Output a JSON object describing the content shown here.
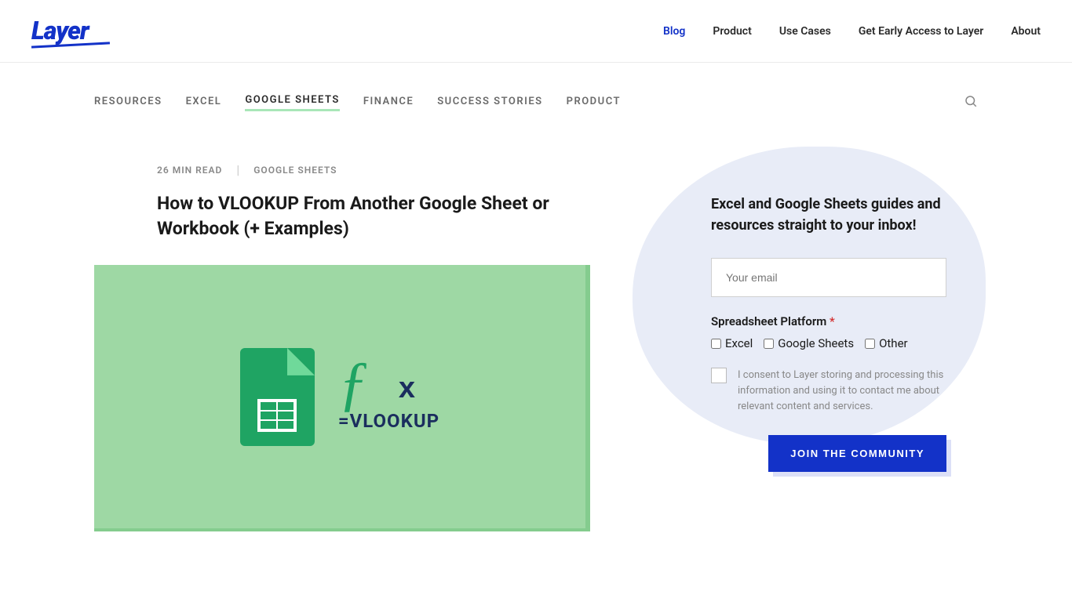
{
  "header": {
    "logo_text": "Layer",
    "nav": [
      {
        "label": "Blog",
        "active": true
      },
      {
        "label": "Product",
        "active": false
      },
      {
        "label": "Use Cases",
        "active": false
      },
      {
        "label": "Get Early Access to Layer",
        "active": false
      },
      {
        "label": "About",
        "active": false
      }
    ]
  },
  "subnav": [
    {
      "label": "RESOURCES",
      "active": false
    },
    {
      "label": "EXCEL",
      "active": false
    },
    {
      "label": "GOOGLE SHEETS",
      "active": true
    },
    {
      "label": "FINANCE",
      "active": false
    },
    {
      "label": "SUCCESS STORIES",
      "active": false
    },
    {
      "label": "PRODUCT",
      "active": false
    }
  ],
  "article": {
    "read_time": "26 MIN READ",
    "category": "GOOGLE SHEETS",
    "title": "How to VLOOKUP From Another Google Sheet or Workbook (+ Examples)",
    "hero_fx_label": "=VLOOKUP"
  },
  "sidebar": {
    "title": "Excel and Google Sheets guides and resources straight to your inbox!",
    "email_placeholder": "Your email",
    "platform_label": "Spreadsheet Platform",
    "platform_options": [
      "Excel",
      "Google Sheets",
      "Other"
    ],
    "consent_text": "I consent to Layer storing and processing this information and using it to contact me about relevant content and services.",
    "join_button": "JOIN THE COMMUNITY"
  }
}
